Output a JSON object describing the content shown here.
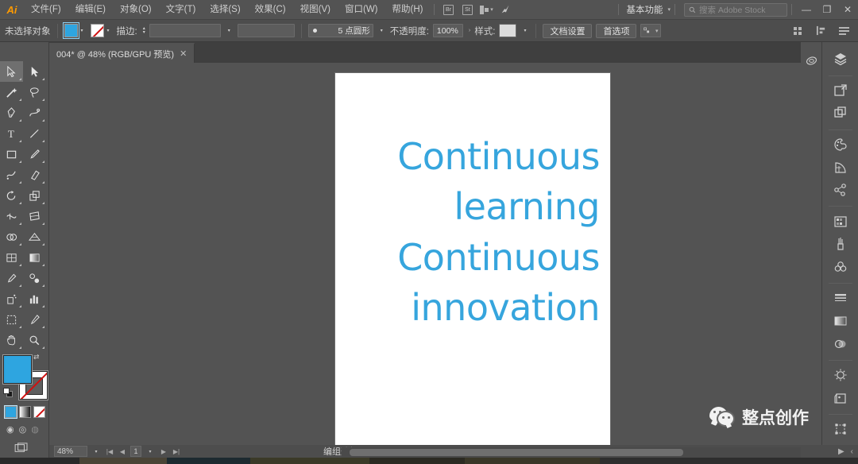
{
  "app": {
    "name": "Adobe Illustrator",
    "logo_text": "Ai"
  },
  "menubar": {
    "items": [
      {
        "label": "文件(F)"
      },
      {
        "label": "编辑(E)"
      },
      {
        "label": "对象(O)"
      },
      {
        "label": "文字(T)"
      },
      {
        "label": "选择(S)"
      },
      {
        "label": "效果(C)"
      },
      {
        "label": "视图(V)"
      },
      {
        "label": "窗口(W)"
      },
      {
        "label": "帮助(H)"
      }
    ],
    "bridge_label": "Br",
    "stock_label": "St",
    "arrange_label": "排列文档",
    "workspace": "基本功能",
    "search_placeholder": "搜索 Adobe Stock",
    "minimize": "—",
    "restore": "❐",
    "close": "✕"
  },
  "controlbar": {
    "selection_status": "未选择对象",
    "fill_color": "#2ea5e0",
    "stroke_label": "描边:",
    "stroke_weight": "",
    "stroke_profile": "",
    "brush_label": "5 点圆形",
    "opacity_label": "不透明度:",
    "opacity_value": "100%",
    "style_label": "样式:",
    "document_setup": "文档设置",
    "preferences": "首选项",
    "align_label": "对齐"
  },
  "tabs": [
    {
      "title": "004* @ 48% (RGB/GPU 预览)",
      "close": "✕",
      "active": true
    }
  ],
  "toolbar": {
    "tools": [
      {
        "name": "selection-tool",
        "active": true
      },
      {
        "name": "direct-selection-tool",
        "active": false
      },
      {
        "name": "magic-wand-tool",
        "active": false
      },
      {
        "name": "lasso-tool",
        "active": false
      },
      {
        "name": "pen-tool",
        "active": false
      },
      {
        "name": "curvature-tool",
        "active": false
      },
      {
        "name": "type-tool",
        "active": false
      },
      {
        "name": "line-segment-tool",
        "active": false
      },
      {
        "name": "rectangle-tool",
        "active": false
      },
      {
        "name": "paintbrush-tool",
        "active": false
      },
      {
        "name": "shaper-tool",
        "active": false
      },
      {
        "name": "eraser-tool",
        "active": false
      },
      {
        "name": "rotate-tool",
        "active": false
      },
      {
        "name": "scale-tool",
        "active": false
      },
      {
        "name": "width-tool",
        "active": false
      },
      {
        "name": "free-transform-tool",
        "active": false
      },
      {
        "name": "shape-builder-tool",
        "active": false
      },
      {
        "name": "perspective-grid-tool",
        "active": false
      },
      {
        "name": "mesh-tool",
        "active": false
      },
      {
        "name": "gradient-tool",
        "active": false
      },
      {
        "name": "eyedropper-tool",
        "active": false
      },
      {
        "name": "blend-tool",
        "active": false
      },
      {
        "name": "symbol-sprayer-tool",
        "active": false
      },
      {
        "name": "column-graph-tool",
        "active": false
      },
      {
        "name": "artboard-tool",
        "active": false
      },
      {
        "name": "slice-tool",
        "active": false
      },
      {
        "name": "hand-tool",
        "active": false
      },
      {
        "name": "zoom-tool",
        "active": false
      }
    ],
    "fill_color": "#2ea5e0",
    "stroke_color": "none",
    "color_modes": [
      {
        "name": "color-mode",
        "selected": true
      },
      {
        "name": "gradient-mode",
        "selected": false
      },
      {
        "name": "none-mode",
        "selected": false
      }
    ]
  },
  "canvas": {
    "artboard_background": "#ffffff",
    "text_color": "#36a5dd",
    "text_lines": [
      "Continuous",
      "learning",
      "Continuous",
      "innovation"
    ]
  },
  "right_dock": {
    "icons": [
      {
        "name": "layers-panel-icon"
      },
      {
        "name": "libraries-panel-icon"
      },
      {
        "name": "artboards-panel-icon"
      },
      {
        "name": "color-panel-icon"
      },
      {
        "name": "color-guide-panel-icon"
      },
      {
        "name": "swatches-panel-icon"
      },
      {
        "name": "brushes-panel-icon"
      },
      {
        "name": "symbols-panel-icon"
      },
      {
        "name": "stroke-panel-icon"
      },
      {
        "name": "gradient-panel-icon"
      },
      {
        "name": "transparency-panel-icon"
      },
      {
        "name": "appearance-panel-icon"
      },
      {
        "name": "graphic-styles-panel-icon"
      },
      {
        "name": "transform-panel-icon"
      },
      {
        "name": "align-panel-icon"
      }
    ],
    "cc-libraries-icon": "cc-libraries-icon"
  },
  "statusbar": {
    "zoom": "48%",
    "artboard_number": "1",
    "current_tool": "编组选择"
  },
  "watermark": {
    "text": "整点创作",
    "logo": "wechat-logo"
  }
}
